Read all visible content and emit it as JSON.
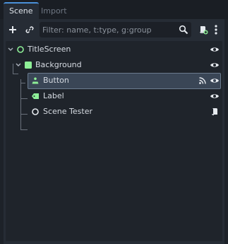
{
  "tabs": [
    {
      "label": "Scene",
      "active": true
    },
    {
      "label": "Import",
      "active": false
    }
  ],
  "toolbar": {
    "add_icon": "plus-icon",
    "link_icon": "chain-link-icon",
    "filter_placeholder": "Filter: name, t:type, g:group",
    "search_icon": "magnifier-icon",
    "script_icon": "attach-script-icon",
    "menu_icon": "vertical-dots-icon"
  },
  "tree": {
    "nodes": [
      {
        "name": "TitleScreen",
        "type_icon": "node2d-circle-icon",
        "expanded": true,
        "visible_toggle": true
      },
      {
        "name": "Background",
        "type_icon": "colorrect-icon",
        "expanded": true,
        "visible_toggle": true
      },
      {
        "name": "Button",
        "type_icon": "button-icon",
        "selected": true,
        "signal_icon": true,
        "visible_toggle": true
      },
      {
        "name": "Label",
        "type_icon": "label-icon",
        "visible_toggle": true
      },
      {
        "name": "Scene Tester",
        "type_icon": "node-circle-icon",
        "script_icon": true
      }
    ]
  },
  "colors": {
    "accent": "#4a90d9",
    "node_green": "#8eef97",
    "background": "#1d2229",
    "panel": "#262c35",
    "selection": "#3a4656"
  }
}
